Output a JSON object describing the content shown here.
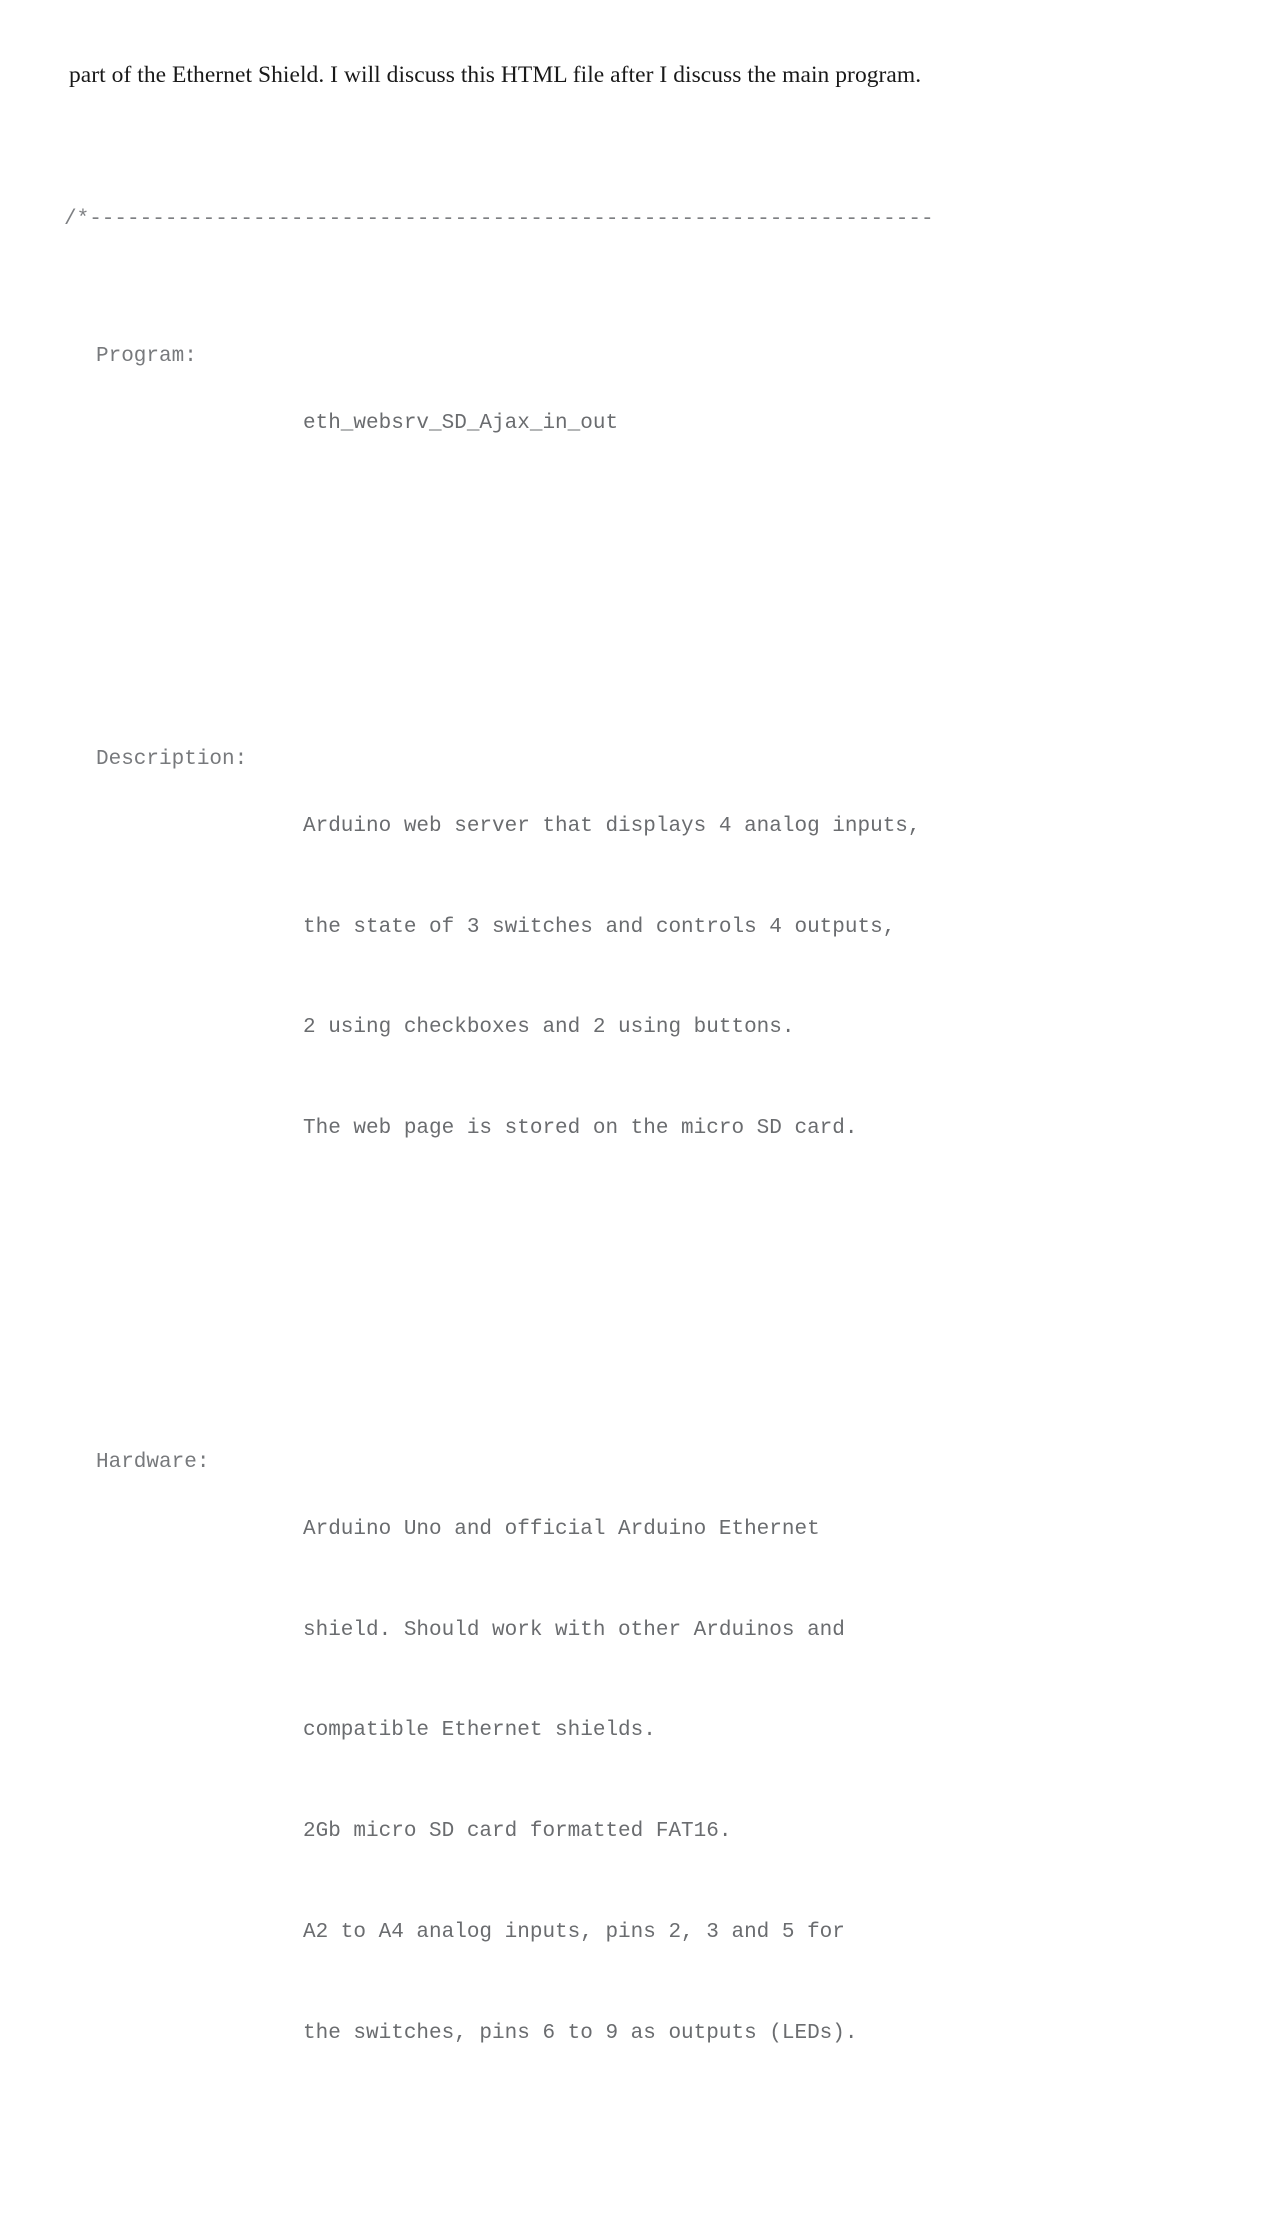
{
  "document": {
    "paragraph": "part of the Ethernet Shield. I will discuss this HTML file after I discuss the main program.",
    "code_comment": {
      "rule": "/*-------------------------------------------------------------------",
      "entries": [
        {
          "label": "Program:",
          "lines": [
            "eth_websrv_SD_Ajax_in_out"
          ]
        },
        {
          "label": "Description:",
          "lines": [
            "Arduino web server that displays 4 analog inputs,",
            "the state of 3 switches and controls 4 outputs,",
            "2 using checkboxes and 2 using buttons.",
            "The web page is stored on the micro SD card."
          ]
        },
        {
          "label": "Hardware:",
          "lines": [
            "Arduino Uno and official Arduino Ethernet",
            "shield. Should work with other Arduinos and",
            "compatible Ethernet shields.",
            "2Gb micro SD card formatted FAT16.",
            "A2 to A4 analog inputs, pins 2, 3 and 5 for",
            "the switches, pins 6 to 9 as outputs (LEDs)."
          ]
        }
      ]
    },
    "colors": {
      "page_background": "#ffffff",
      "prose_text": "#1b1b1b",
      "code_text": "#6d6f72",
      "rule_text": "#7d7f82"
    }
  }
}
